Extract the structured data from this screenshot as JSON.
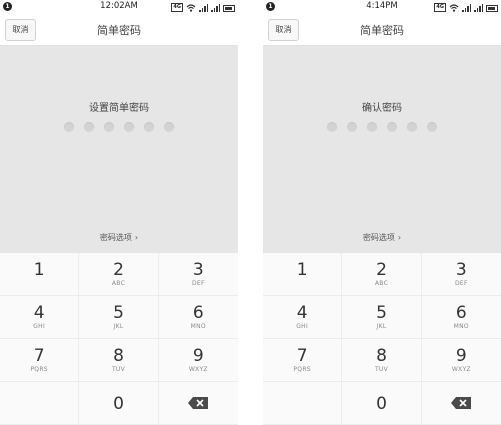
{
  "screens": [
    {
      "status": {
        "time": "12:02AM",
        "notification": "1",
        "badge": "4G"
      },
      "header": {
        "cancel_label": "取消",
        "title": "简单密码"
      },
      "prompt": "设置简单密码",
      "options_label": "密码选项",
      "chevron": "›"
    },
    {
      "status": {
        "time": "4:14PM",
        "notification": "1",
        "badge": "4G"
      },
      "header": {
        "cancel_label": "取消",
        "title": "简单密码"
      },
      "prompt": "确认密码",
      "options_label": "密码选项",
      "chevron": "›"
    }
  ],
  "keypad": {
    "keys": [
      {
        "num": "1",
        "letters": ""
      },
      {
        "num": "2",
        "letters": "ABC"
      },
      {
        "num": "3",
        "letters": "DEF"
      },
      {
        "num": "4",
        "letters": "GHI"
      },
      {
        "num": "5",
        "letters": "JKL"
      },
      {
        "num": "6",
        "letters": "MNO"
      },
      {
        "num": "7",
        "letters": "PQRS"
      },
      {
        "num": "8",
        "letters": "TUV"
      },
      {
        "num": "9",
        "letters": "WXYZ"
      },
      {
        "num": "0",
        "letters": ""
      }
    ],
    "backspace_icon": "backspace-icon"
  },
  "colors": {
    "entry_background": "#e6e6e6",
    "dot": "#d3d3d3",
    "keypad_background": "#fafafa"
  }
}
